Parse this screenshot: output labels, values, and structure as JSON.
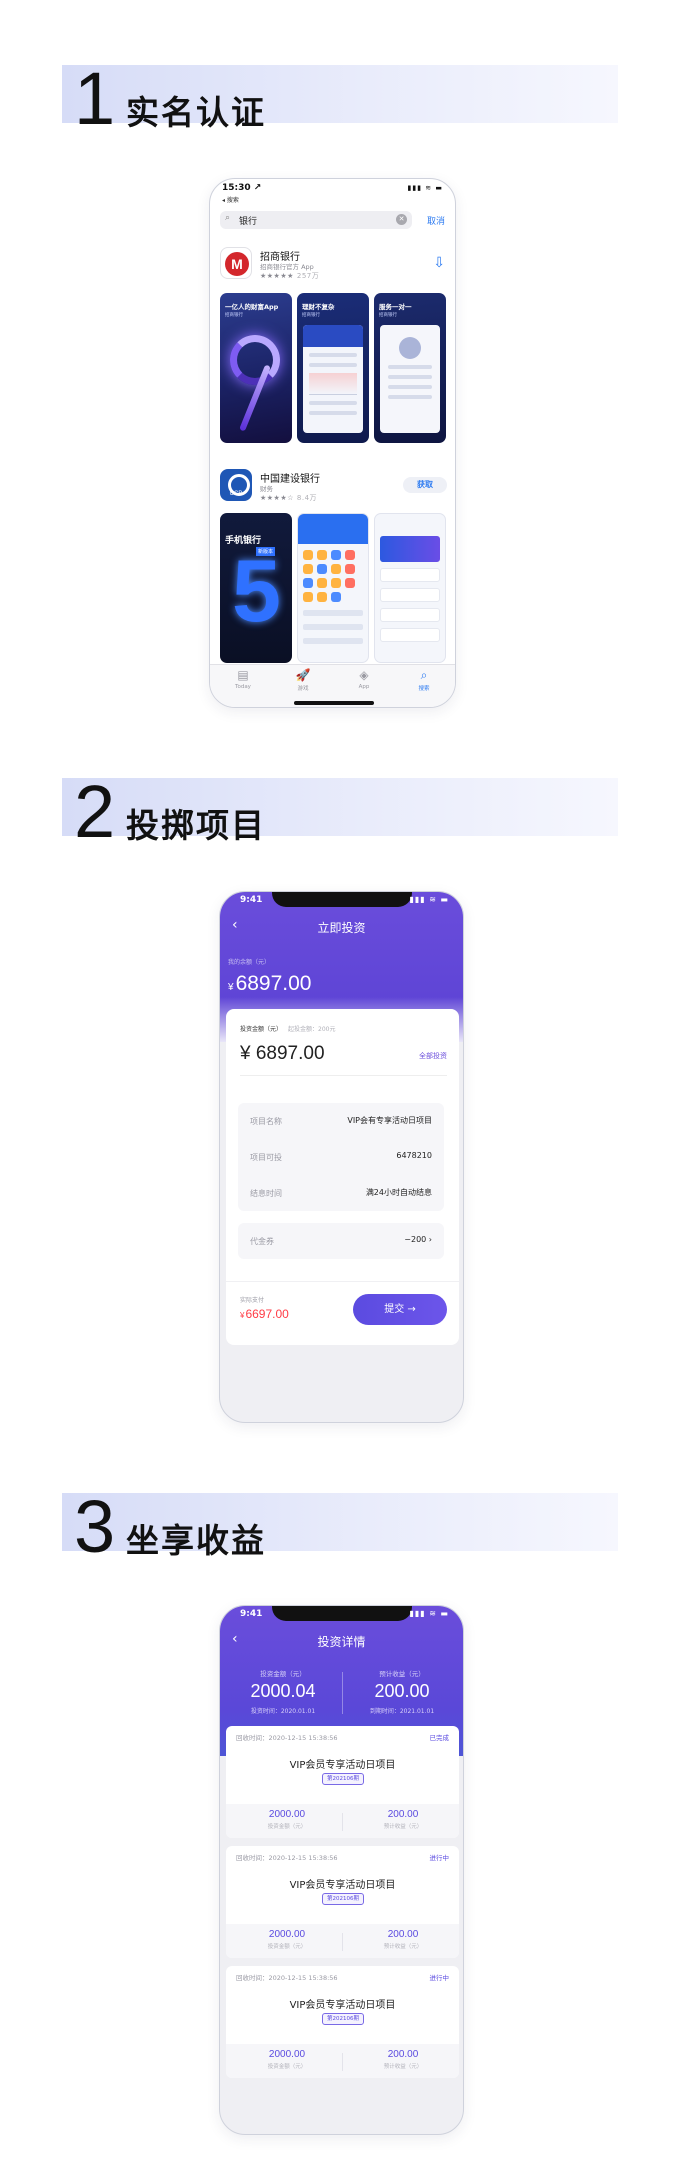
{
  "steps": [
    {
      "num": "1",
      "title": "实名认证"
    },
    {
      "num": "2",
      "title": "投掷项目"
    },
    {
      "num": "3",
      "title": "坐享收益"
    }
  ],
  "phone1": {
    "status": {
      "time": "15:30 ↗",
      "back": "◂ 搜索",
      "icons": "▮▮▮ ≋ ▬"
    },
    "search": {
      "query": "银行",
      "cancel": "取消"
    },
    "apps": [
      {
        "name": "招商银行",
        "sub": "招商银行官方 App",
        "stars": "★★★★★",
        "count": "257万",
        "action": "download"
      },
      {
        "name": "中国建设银行",
        "sub": "财务",
        "stars": "★★★★☆",
        "count": "8.4万",
        "action": "获取"
      }
    ],
    "shots": {
      "s1": {
        "cap": "一亿人的财富App",
        "sub": "招商银行"
      },
      "s2": {
        "cap": "理财不复杂",
        "sub": "招商银行"
      },
      "s3": {
        "cap": "服务一对一",
        "sub": "招商银行"
      },
      "s4": {
        "cap": "手机银行",
        "tag": "新版本"
      }
    },
    "tabs": [
      {
        "glyph": "▤",
        "label": "Today"
      },
      {
        "glyph": "🚀",
        "label": "游戏"
      },
      {
        "glyph": "◈",
        "label": "App"
      },
      {
        "glyph": "⌕",
        "label": "搜索"
      }
    ]
  },
  "phone2": {
    "status": {
      "time": "9:41",
      "icons": "▮▮▮ ≋ ▬"
    },
    "nav": {
      "back": "‹",
      "title": "立即投资"
    },
    "balance": {
      "label": "我的余额（元）",
      "currency": "¥",
      "value": "6897.00"
    },
    "amount": {
      "label": "投资金额（元）",
      "hint": "起投金额：200元",
      "value": "¥ 6897.00",
      "all_in": "全部投资"
    },
    "info": [
      {
        "k": "项目名称",
        "v": "VIP会有专享活动日项目"
      },
      {
        "k": "项目可投",
        "v": "6478210"
      },
      {
        "k": "结息时间",
        "v": "满24小时自动结息"
      }
    ],
    "voucher": {
      "k": "代金券",
      "v": "−200 ›"
    },
    "pay": {
      "label": "实际支付",
      "currency": "¥",
      "value": "6697.00"
    },
    "submit": "提交 →"
  },
  "phone3": {
    "status": {
      "time": "9:41",
      "icons": "▮▮▮ ≋ ▬"
    },
    "nav": {
      "back": "‹",
      "title": "投资详情"
    },
    "summary": [
      {
        "label": "投资金额（元）",
        "value": "2000.04",
        "date": "投资时间：2020.01.01"
      },
      {
        "label": "预计收益（元）",
        "value": "200.00",
        "date": "到期时间：2021.01.01"
      }
    ],
    "records": [
      {
        "time": "回收时间：2020-12-15 15:38:56",
        "status": "已完成",
        "name": "VIP会员专享活动日项目",
        "issue": "第202106期",
        "amount": "2000.00",
        "amount_label": "投资金额（元）",
        "income": "200.00",
        "income_label": "预计收益（元）"
      },
      {
        "time": "回收时间：2020-12-15 15:38:56",
        "status": "进行中",
        "name": "VIP会员专享活动日项目",
        "issue": "第202106期",
        "amount": "2000.00",
        "amount_label": "投资金额（元）",
        "income": "200.00",
        "income_label": "预计收益（元）"
      },
      {
        "time": "回收时间：2020-12-15 15:38:56",
        "status": "进行中",
        "name": "VIP会员专享活动日项目",
        "issue": "第202106期",
        "amount": "2000.00",
        "amount_label": "投资金额（元）",
        "income": "200.00",
        "income_label": "预计收益（元）"
      }
    ]
  },
  "colors": {
    "accent": "#5b4be0",
    "header_purple": "#6a4ddb",
    "pay_red": "#ff3b45",
    "ios_blue": "#2d7bf1"
  }
}
